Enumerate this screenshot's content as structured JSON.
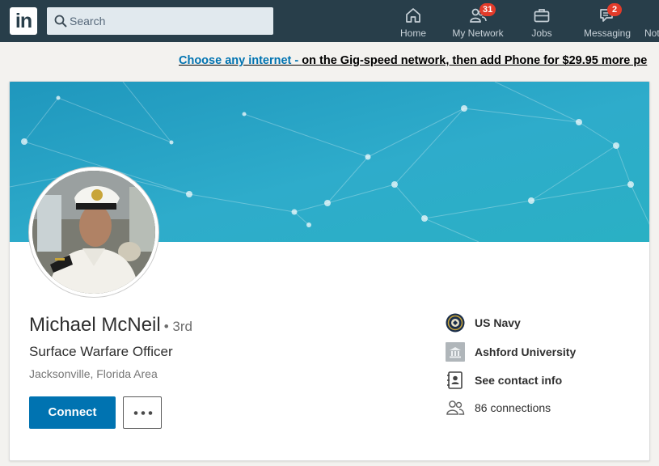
{
  "nav": {
    "logo_text": "in",
    "search_placeholder": "Search",
    "items": [
      {
        "label": "Home",
        "icon": "home-icon"
      },
      {
        "label": "My Network",
        "icon": "network-icon",
        "badge": "31"
      },
      {
        "label": "Jobs",
        "icon": "briefcase-icon"
      },
      {
        "label": "Messaging",
        "icon": "messaging-icon",
        "badge": "2"
      },
      {
        "label": "Not",
        "icon": "notifications-icon"
      }
    ]
  },
  "ad": {
    "link_text": "Choose any internet - ",
    "rest_text": "on the Gig-speed network, then add Phone for $29.95 more pe"
  },
  "profile": {
    "name": "Michael McNeil",
    "degree": "• 3rd",
    "headline": "Surface Warfare Officer",
    "location": "Jacksonville, Florida Area",
    "connect_label": "Connect",
    "more_label": "More actions"
  },
  "sidebar": {
    "company": "US Navy",
    "school": "Ashford University",
    "contact": "See contact info",
    "connections": "86 connections"
  },
  "colors": {
    "nav_bg": "#283e4a",
    "accent": "#0073b1",
    "badge": "#e33b2a",
    "banner": "#2aa3c4"
  }
}
